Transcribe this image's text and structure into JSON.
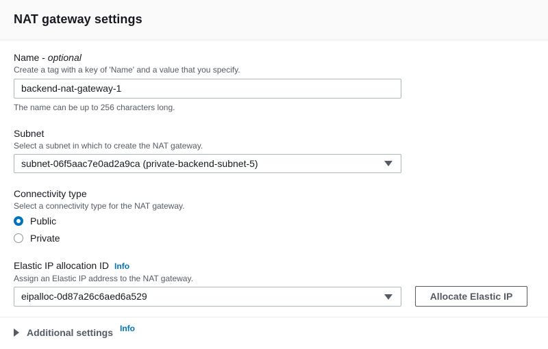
{
  "header": {
    "title": "NAT gateway settings"
  },
  "name_field": {
    "label": "Name - ",
    "label_optional": "optional",
    "description": "Create a tag with a key of 'Name' and a value that you specify.",
    "value": "backend-nat-gateway-1",
    "constraint": "The name can be up to 256 characters long."
  },
  "subnet_field": {
    "label": "Subnet",
    "description": "Select a subnet in which to create the NAT gateway.",
    "selected": "subnet-06f5aac7e0ad2a9ca (private-backend-subnet-5)"
  },
  "connectivity": {
    "label": "Connectivity type",
    "description": "Select a connectivity type for the NAT gateway.",
    "options": [
      {
        "label": "Public",
        "checked": true
      },
      {
        "label": "Private",
        "checked": false
      }
    ]
  },
  "eip_field": {
    "label": "Elastic IP allocation ID",
    "info": "Info",
    "description": "Assign an Elastic IP address to the NAT gateway.",
    "selected": "eipalloc-0d87a26c6aed6a529",
    "button_label": "Allocate Elastic IP"
  },
  "additional": {
    "label": "Additional settings",
    "info": "Info"
  },
  "colors": {
    "accent": "#0073bb",
    "text": "#16191f",
    "muted": "#545b64",
    "border": "#aab7b8"
  }
}
